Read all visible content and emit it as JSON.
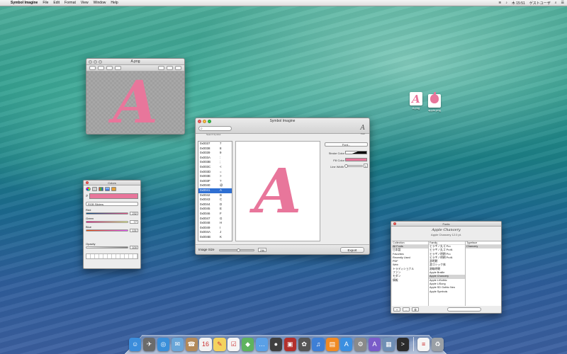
{
  "menubar": {
    "app_name": "Symbol Imagine",
    "menus": [
      "File",
      "Edit",
      "Format",
      "View",
      "Window",
      "Help"
    ],
    "clock": "木 15:51",
    "user": "ゲストユーザ"
  },
  "preview_window": {
    "title": "A.png",
    "glyph": "A"
  },
  "main_window": {
    "title": "Symbol Imagine",
    "search_label": "Search Symbol",
    "font_button_label": "Font",
    "codes": [
      {
        "code": "0x0037",
        "glyph": "7"
      },
      {
        "code": "0x0038",
        "glyph": "8"
      },
      {
        "code": "0x0039",
        "glyph": "9"
      },
      {
        "code": "0x003A",
        "glyph": ":"
      },
      {
        "code": "0x003B",
        "glyph": ";"
      },
      {
        "code": "0x003C",
        "glyph": "<"
      },
      {
        "code": "0x003D",
        "glyph": "="
      },
      {
        "code": "0x003E",
        "glyph": ">"
      },
      {
        "code": "0x003F",
        "glyph": "?"
      },
      {
        "code": "0x0040",
        "glyph": "@"
      },
      {
        "code": "0x0041",
        "glyph": "A"
      },
      {
        "code": "0x0042",
        "glyph": "B"
      },
      {
        "code": "0x0043",
        "glyph": "C"
      },
      {
        "code": "0x0044",
        "glyph": "D"
      },
      {
        "code": "0x0045",
        "glyph": "E"
      },
      {
        "code": "0x0046",
        "glyph": "F"
      },
      {
        "code": "0x0047",
        "glyph": "G"
      },
      {
        "code": "0x0048",
        "glyph": "H"
      },
      {
        "code": "0x0049",
        "glyph": "I"
      },
      {
        "code": "0x004A",
        "glyph": "J"
      },
      {
        "code": "0x004B",
        "glyph": "K"
      }
    ],
    "selected_index": 10,
    "preview_glyph": "A",
    "font_popup": "Font...",
    "stroke_color_label": "Stroke Color",
    "fill_color_label": "Fill Color",
    "line_width_label": "Line Width",
    "line_width_value": "1",
    "image_size_label": "Image Size",
    "image_size_value": "256",
    "export_label": "Export",
    "fill_color": "#e8769b"
  },
  "colors_panel": {
    "title": "Colors",
    "dropdown": "RGB Sliders",
    "red_label": "Red",
    "red_value": "232",
    "green_label": "Green",
    "green_value": "77",
    "blue_label": "Blue",
    "blue_value": "131",
    "opacity_label": "Opacity",
    "opacity_value": "100"
  },
  "fonts_panel": {
    "title": "Fonts",
    "sample_name": "Apple Chancery",
    "sample_detail": "Apple Chancery 12.0 pt.",
    "col_collection": "Collection",
    "col_family": "Family",
    "col_typeface": "Typeface",
    "collections": [
      "All Fonts",
      "日本語",
      "Favorites",
      "Recently Used",
      "PDF",
      "Web",
      "トラディショナル",
      "ファン",
      "モダン",
      "情報"
    ],
    "families": [
      "ヒラギノ丸ゴ Pro",
      "ヒラギノ丸ゴ ProN",
      "ヒラギノ明朝 Pro",
      "ヒラギノ明朝 ProN",
      "游明朝",
      "游ゴシック体",
      "源暎明朝",
      "Apple Braille",
      "Apple Chancery",
      "Apple LiGothic",
      "Apple LiSung",
      "Apple SD Gothic Neo",
      "Apple Symbols"
    ],
    "selected_family_index": 8,
    "typefaces": [
      "Chancery"
    ],
    "footer_buttons": [
      "+",
      "-",
      "⚙"
    ]
  },
  "desktop_icons": [
    {
      "label": "A.png"
    },
    {
      "label": "apple.png"
    }
  ],
  "dock": {
    "icons": [
      {
        "name": "finder-icon",
        "glyph": "☺",
        "color": "#3c8ddb"
      },
      {
        "name": "launchpad-icon",
        "glyph": "✈",
        "color": "#6b6b6b"
      },
      {
        "name": "safari-icon",
        "glyph": "◎",
        "color": "#3a8fd9"
      },
      {
        "name": "mail-icon",
        "glyph": "✉",
        "color": "#6aa6d8"
      },
      {
        "name": "contacts-icon",
        "glyph": "☎",
        "color": "#b38a5a"
      },
      {
        "name": "calendar-icon",
        "glyph": "16",
        "color": "#f2f2f2"
      },
      {
        "name": "notes-icon",
        "glyph": "✎",
        "color": "#f4d35e"
      },
      {
        "name": "reminders-icon",
        "glyph": "☑",
        "color": "#f5f5f5"
      },
      {
        "name": "maps-icon",
        "glyph": "◆",
        "color": "#5fb35f"
      },
      {
        "name": "messages-icon",
        "glyph": "…",
        "color": "#5aa0e6"
      },
      {
        "name": "facetime-icon",
        "glyph": "●",
        "color": "#3f3f3f"
      },
      {
        "name": "photobooth-icon",
        "glyph": "▣",
        "color": "#b3302c"
      },
      {
        "name": "photos-icon",
        "glyph": "✿",
        "color": "#555555"
      },
      {
        "name": "itunes-icon",
        "glyph": "♫",
        "color": "#3e7fd6"
      },
      {
        "name": "ibooks-icon",
        "glyph": "▤",
        "color": "#f08a24"
      },
      {
        "name": "appstore-icon",
        "glyph": "A",
        "color": "#3b8fe0"
      },
      {
        "name": "preferences-icon",
        "glyph": "⚙",
        "color": "#8a8a8a"
      },
      {
        "name": "symbol-imagine-icon",
        "glyph": "A",
        "color": "#7a5cc9"
      },
      {
        "name": "preview-icon",
        "glyph": "▦",
        "color": "#6f8fb5"
      },
      {
        "name": "terminal-icon",
        "glyph": ">",
        "color": "#2b2b2b"
      },
      {
        "name": "document-icon",
        "glyph": "≡",
        "color": "#f5f5f5"
      },
      {
        "name": "trash-icon",
        "glyph": "♻",
        "color": "#9aa0a6"
      }
    ]
  }
}
